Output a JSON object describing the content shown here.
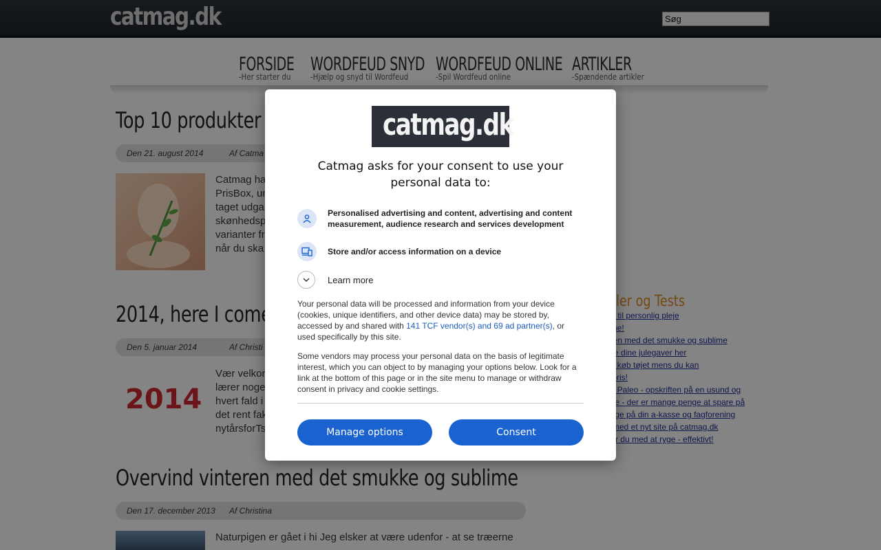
{
  "header": {
    "logo": "catmag.dk",
    "search_value": "Søg"
  },
  "nav": [
    {
      "title": "FORSIDE",
      "subtitle": "-Her starter du"
    },
    {
      "title": "WORDFEUD SNYD",
      "subtitle": "-Hjælp og snyd til Wordfeud"
    },
    {
      "title": "WORDFEUD ONLINE",
      "subtitle": "-Spil Wordfeud online"
    },
    {
      "title": "ARTIKLER",
      "subtitle": "-Spændende artikler"
    }
  ],
  "posts": [
    {
      "title": "Top 10 produkter til",
      "date": "Den 21. august 2014",
      "author": "Af Catma",
      "excerpt": [
        "Catmag ha",
        "PrisBox, ur",
        "taget udga",
        "skønhedsp",
        "varianter fr",
        "når du ska"
      ]
    },
    {
      "title": "2014, here I come!",
      "date": "Den 5. januar 2014",
      "author": "Af Christi",
      "thumb_text": "2014",
      "excerpt": [
        "Vær velkor",
        "lærer noge",
        "hvert fald i",
        "det rent fak",
        "nytårsforTs"
      ]
    },
    {
      "title": "Overvind vinteren med det smukke og sublime",
      "date": "Den 17. december 2013",
      "author": "Af Christina",
      "excerpt": [
        "Naturpigen er gået i hi  Jeg elsker at være udenfor - at se træerne"
      ]
    }
  ],
  "sidebar": {
    "title": "ikler og Tests",
    "links": [
      "ter til personlig pleje",
      "ome!",
      "eren med det smukke og sublime",
      "alle dine julegaver her",
      "s - køb tøjet mens du kan",
      "v pris!",
      "og Paleo - opskriften på en usund og",
      "",
      "nge - der er mange penge at spare på",
      "",
      "enge på din a-kasse og fagforening",
      "n med et nyt site på catmag.dk",
      "Sådan stopper du med at ryge - effektivt!"
    ]
  },
  "consent": {
    "logo": "catmag.dk",
    "heading": "Catmag asks for your consent to use your personal data to:",
    "purposes": [
      {
        "icon": "person-icon",
        "text": "Personalised advertising and content, advertising and content measurement, audience research and services development"
      },
      {
        "icon": "devices-icon",
        "text": "Store and/or access information on a device"
      }
    ],
    "learn_more": "Learn more",
    "para1_before": "Your personal data will be processed and information from your device (cookies, unique identifiers, and other device data) may be stored by, accessed by and shared with ",
    "para1_link": "141 TCF vendor(s) and 69 ad partner(s)",
    "para1_after": ", or used specifically by this site.",
    "para2": "Some vendors may process your personal data on the basis of legitimate interest, which you can object to by managing your options below. Look for a link at the bottom of this page or in the site menu to manage or withdraw consent in privacy and cookie settings.",
    "manage_label": "Manage options",
    "consent_label": "Consent"
  },
  "colors": {
    "accent": "#1a62d0",
    "sidebar_title": "#d4821f",
    "topbar": "#22272e"
  }
}
